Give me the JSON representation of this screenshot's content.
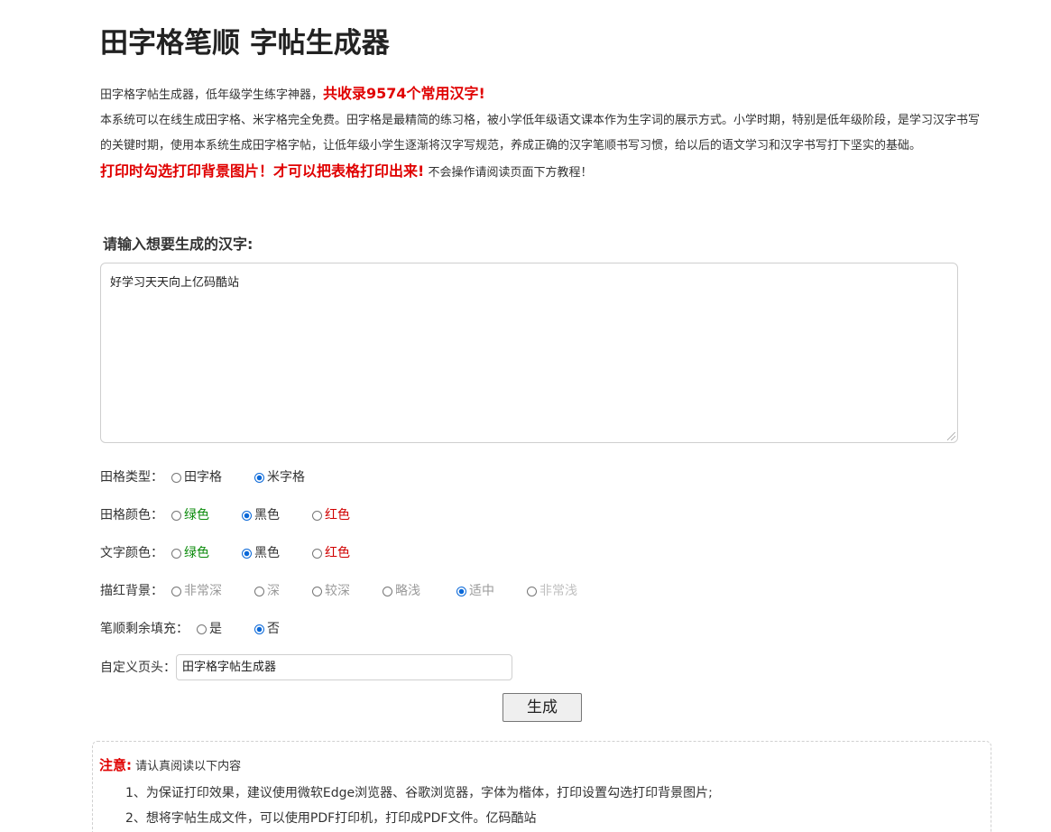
{
  "title": "田字格笔顺 字帖生成器",
  "intro": {
    "line1_prefix": "田字格字帖生成器，低年级学生练字神器，",
    "line1_emph": "共收录9574个常用汉字!",
    "para": "本系统可以在线生成田字格、米字格完全免费。田字格是最精简的练习格，被小学低年级语文课本作为生字词的展示方式。小学时期，特别是低年级阶段，是学习汉字书写的关键时期，使用本系统生成田字格字帖，让低年级小学生逐渐将汉字写规范，养成正确的汉字笔顺书写习惯，给以后的语文学习和汉字书写打下坚实的基础。",
    "print_emph": "打印时勾选打印背景图片！才可以把表格打印出来!",
    "print_note": "不会操作请阅读页面下方教程！"
  },
  "input_label": "请输入想要生成的汉字:",
  "input_value": "好学习天天向上亿码酷站",
  "options": {
    "grid_type": {
      "label": "田格类型：",
      "choices": [
        {
          "label": "田字格",
          "selected": false
        },
        {
          "label": "米字格",
          "selected": true
        }
      ]
    },
    "grid_color": {
      "label": "田格颜色：",
      "choices": [
        {
          "label": "绿色",
          "selected": false,
          "color": "#0a8a0a"
        },
        {
          "label": "黑色",
          "selected": true,
          "color": "#222222"
        },
        {
          "label": "红色",
          "selected": false,
          "color": "#d00000"
        }
      ]
    },
    "text_color": {
      "label": "文字颜色：",
      "choices": [
        {
          "label": "绿色",
          "selected": false,
          "color": "#0a8a0a"
        },
        {
          "label": "黑色",
          "selected": true,
          "color": "#222222"
        },
        {
          "label": "红色",
          "selected": false,
          "color": "#d00000"
        }
      ]
    },
    "trace_bg": {
      "label": "描红背景：",
      "choices": [
        {
          "label": "非常深",
          "selected": false
        },
        {
          "label": "深",
          "selected": false
        },
        {
          "label": "较深",
          "selected": false
        },
        {
          "label": " 略浅",
          "selected": false
        },
        {
          "label": "适中",
          "selected": true
        },
        {
          "label": "非常浅",
          "selected": false
        }
      ]
    },
    "stroke_fill": {
      "label": "笔顺剩余填充：",
      "choices": [
        {
          "label": "是",
          "selected": false
        },
        {
          "label": "否",
          "selected": true
        }
      ]
    }
  },
  "custom_header": {
    "label": "自定义页头：",
    "value": "田字格字帖生成器"
  },
  "generate_label": "生成",
  "notice": {
    "title": "注意:",
    "subtitle": "请认真阅读以下内容",
    "items": [
      "1、为保证打印效果，建议使用微软Edge浏览器、谷歌浏览器，字体为楷体，打印设置勾选打印背景图片;",
      "2、想将字帖生成文件，可以使用PDF打印机，打印成PDF文件。亿码酷站"
    ]
  }
}
